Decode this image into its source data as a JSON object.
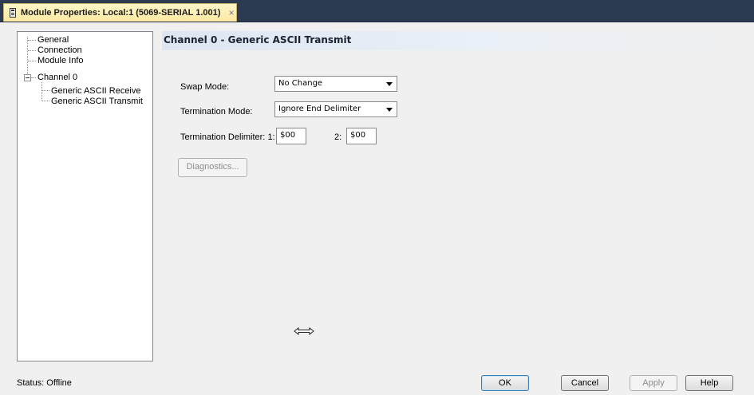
{
  "window": {
    "tab_title": "Module Properties: Local:1 (5069-SERIAL 1.001)",
    "close_glyph": "×"
  },
  "tree": {
    "items": [
      {
        "label": "General"
      },
      {
        "label": "Connection"
      },
      {
        "label": "Module Info"
      },
      {
        "label": "Channel 0",
        "expanded": true
      },
      {
        "label": "Generic ASCII Receive"
      },
      {
        "label": "Generic ASCII Transmit",
        "selected": true
      }
    ]
  },
  "panel": {
    "title": "Channel 0 - Generic ASCII Transmit",
    "swap_mode": {
      "label": "Swap Mode:",
      "value": "No Change"
    },
    "termination_mode": {
      "label": "Termination Mode:",
      "value": "Ignore End Delimiter"
    },
    "termination_delimiter": {
      "label": "Termination Delimiter:",
      "field1_label": "1:",
      "field1_value": "$00",
      "field2_label": "2:",
      "field2_value": "$00"
    },
    "diagnostics_label": "Diagnostics...",
    "resize_icon": "horizontal-resize-arrow-icon"
  },
  "footer": {
    "status": "Status:  Offline",
    "ok_label": "OK",
    "cancel_label": "Cancel",
    "apply_label": "Apply",
    "help_label": "Help"
  },
  "colors": {
    "title_bar": "#2c3a52",
    "tab_background": "#fde9a1",
    "header_gradient_start": "#dde6f1"
  }
}
